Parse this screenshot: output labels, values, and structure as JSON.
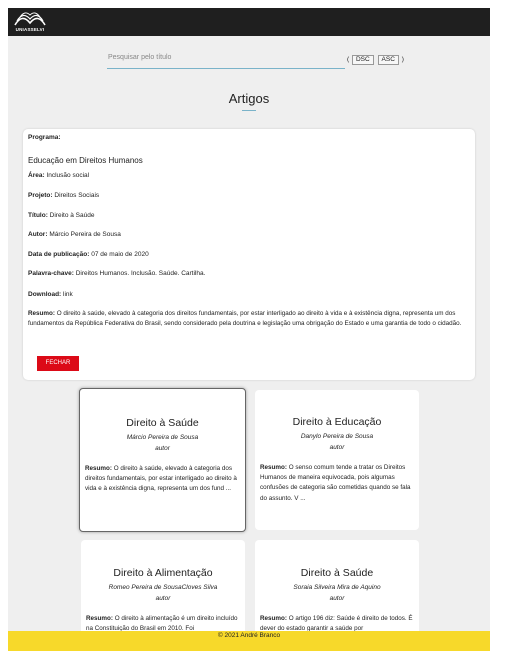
{
  "header": {
    "logo_text": "UNIASSELVI",
    "logo_icon": "wave-book-logo-icon"
  },
  "search": {
    "placeholder": "Pesquisar pelo título",
    "sort_open": "(",
    "sort_close": ")",
    "dsc_label": "DSC",
    "asc_label": "ASC"
  },
  "page_title": "Artigos",
  "detail": {
    "programa_label": "Programa:",
    "programa_value": "Educação em Direitos Humanos",
    "area_label": "Área:",
    "area_value": "Inclusão social",
    "projeto_label": "Projeto:",
    "projeto_value": "Direitos Sociais",
    "titulo_label": "Título:",
    "titulo_value": "Direito à Saúde",
    "autor_label": "Autor:",
    "autor_value": "Márcio Pereira de Sousa",
    "data_label": "Data de publicação:",
    "data_value": "07 de maio de 2020",
    "palavra_label": "Palavra-chave:",
    "palavra_value": "Direitos Humanos. Inclusão. Saúde. Cartilha.",
    "download_label": "Download:",
    "download_value": "link",
    "resumo_label": "Resumo:",
    "resumo_value": "O direito à saúde, elevado à categoria dos direitos fundamentais, por estar interligado ao direito à vida e à existência digna, representa um dos fundamentos da República Federativa do Brasil, sendo considerado pela doutrina e legislação uma obrigação do Estado e uma garantia de todo o cidadão.",
    "close_label": "FECHAR"
  },
  "cards": [
    {
      "title": "Direito à Saúde",
      "author": "Márcio Pereira de Sousa",
      "role": "autor",
      "resumo_label": "Resumo:",
      "resumo": "O direito à saúde, elevado à categoria dos direitos fundamentais, por estar interligado ao direito à vida e à existência digna, representa um dos fund ..."
    },
    {
      "title": "Direito à Educação",
      "author": "Danylo Pereira de Sousa",
      "role": "autor",
      "resumo_label": "Resumo:",
      "resumo": "O senso comum tende a tratar os Direitos Humanos de maneira equivocada, pois algumas confusões de categoria são cometidas quando se fala do assunto. V ..."
    },
    {
      "title": "Direito à Alimentação",
      "author": "Romeo Pereira de SousaCloves Silva",
      "role": "autor",
      "resumo_label": "Resumo:",
      "resumo": "O direito à alimentação é um direito incluído na Constituição do Brasil em 2010. Foi"
    },
    {
      "title": "Direito à Saúde",
      "author": "Soraia Silveira Mira de Aquino",
      "role": "autor",
      "resumo_label": "Resumo:",
      "resumo": "O artigo 196 diz: Saúde é direito de todos. É dever do estado garantir a saúde por"
    }
  ],
  "footer": {
    "text": "© 2021 André Branco"
  }
}
